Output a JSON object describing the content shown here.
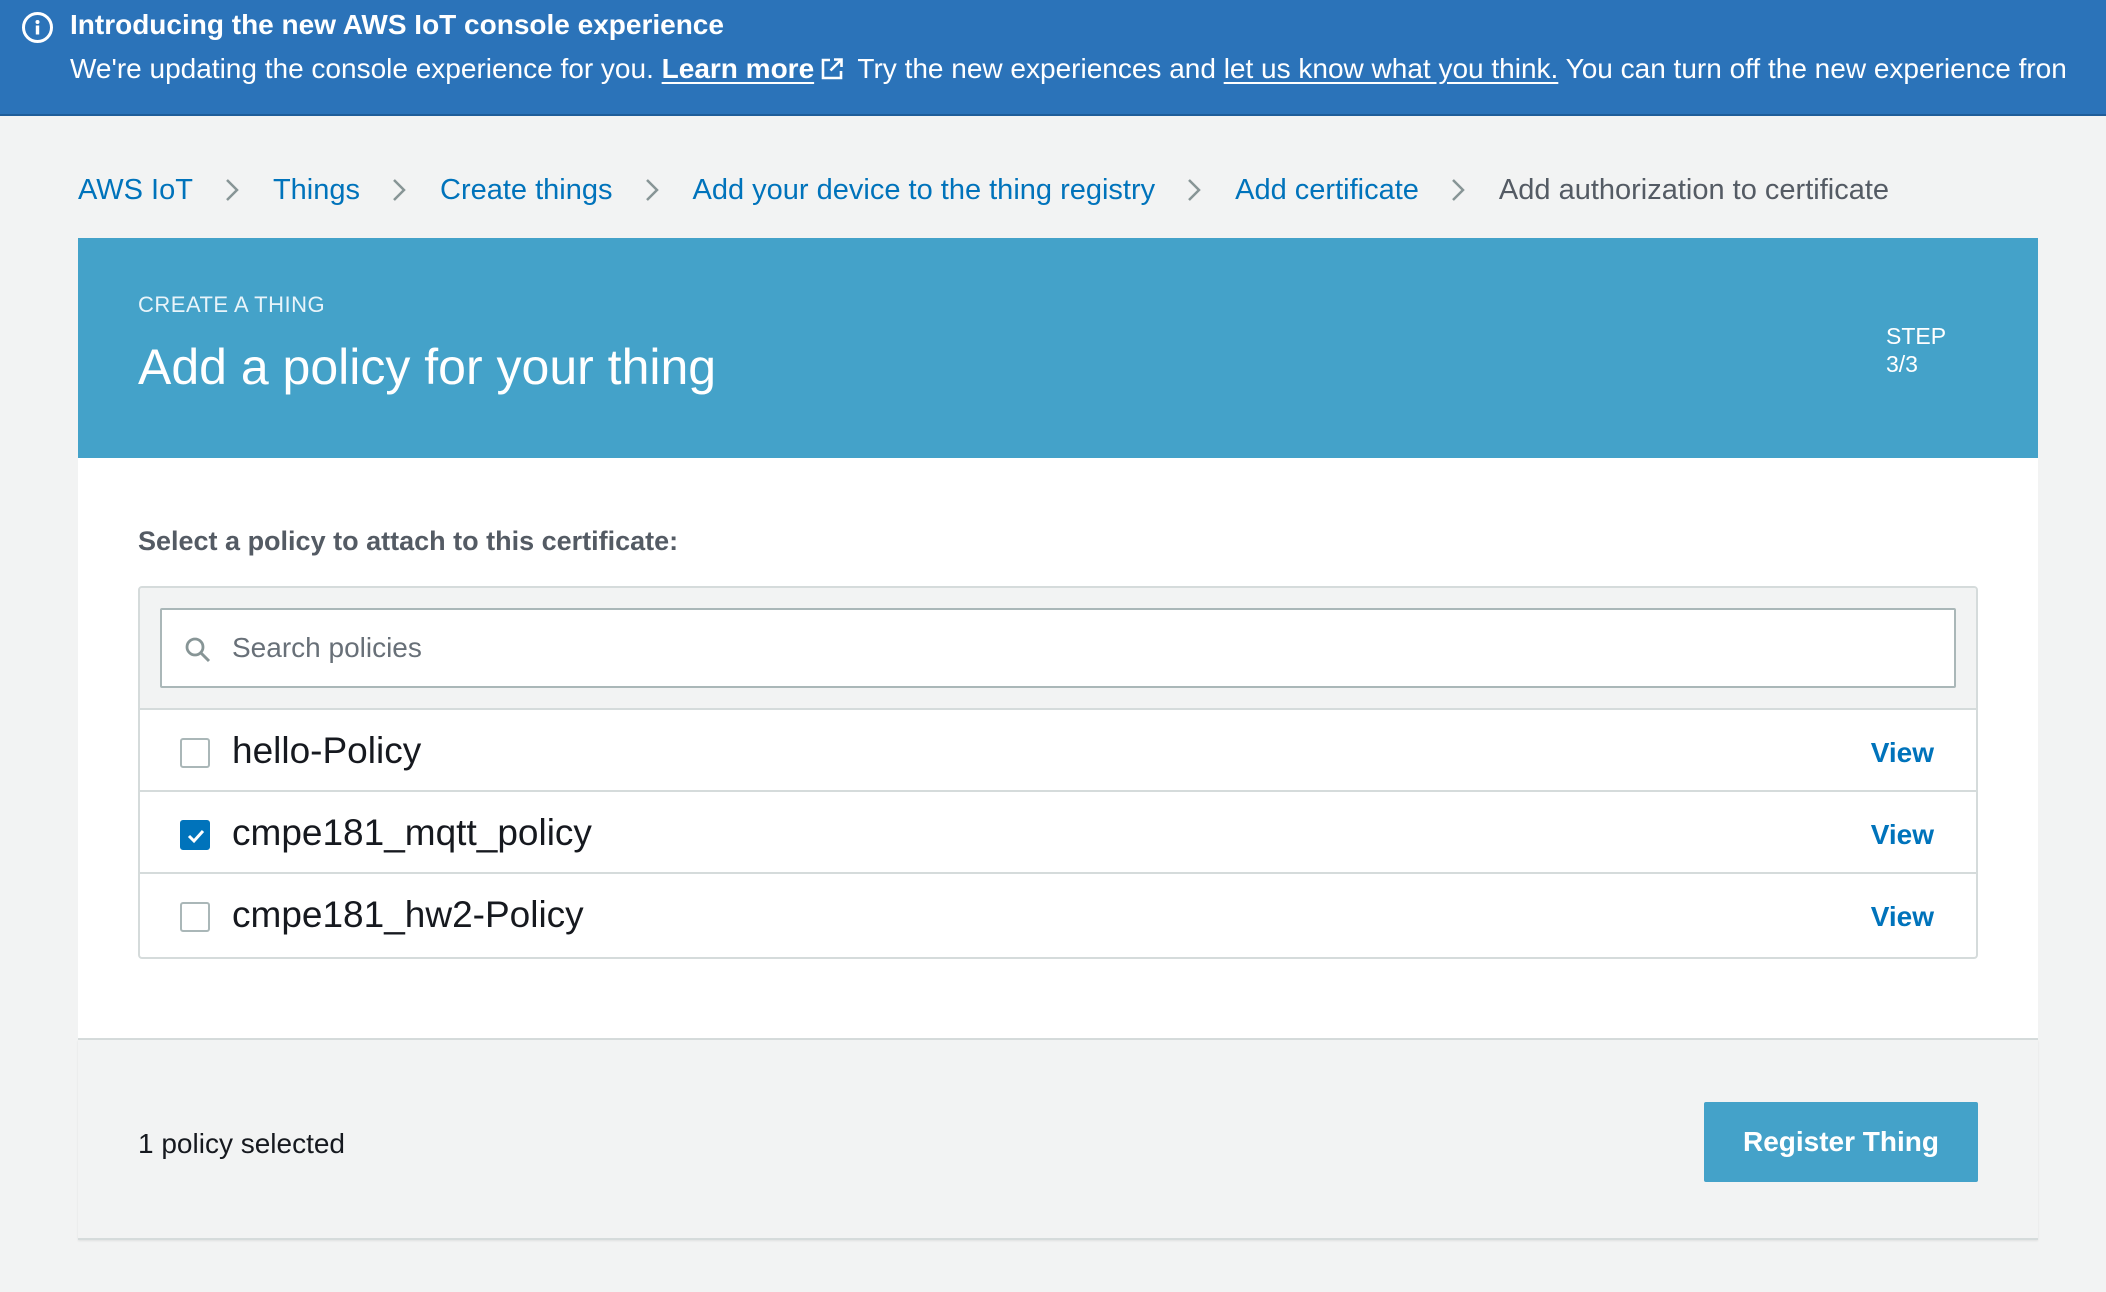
{
  "banner": {
    "title": "Introducing the new AWS IoT console experience",
    "text_before": "We're updating the console experience for you. ",
    "learn_more": "Learn more",
    "text_middle": " Try the new experiences and ",
    "feedback_link": "let us know what you think.",
    "text_after": " You can turn off the new experience fron"
  },
  "breadcrumb": {
    "items": [
      "AWS IoT",
      "Things",
      "Create things",
      "Add your device to the thing registry",
      "Add certificate",
      "Add authorization to certificate"
    ]
  },
  "header": {
    "kicker": "CREATE A THING",
    "title": "Add a policy for your thing",
    "step_label": "STEP",
    "step_value": "3/3"
  },
  "content": {
    "section_label": "Select a policy to attach to this certificate:",
    "search_placeholder": "Search policies",
    "search_value": "",
    "policies": [
      {
        "name": "hello-Policy",
        "checked": false,
        "action": "View"
      },
      {
        "name": "cmpe181_mqtt_policy",
        "checked": true,
        "action": "View"
      },
      {
        "name": "cmpe181_hw2-Policy",
        "checked": false,
        "action": "View"
      }
    ]
  },
  "footer": {
    "selected_count": "1 policy selected",
    "register_label": "Register Thing"
  },
  "icons": {
    "banner": "info-circle-icon",
    "external": "external-link-icon",
    "separator": "chevron-right-icon",
    "search": "search-icon",
    "check": "checkmark-icon"
  },
  "colors": {
    "banner_bg": "#2b73b9",
    "header_bg": "#44a2c9",
    "link": "#0073bb",
    "button_bg": "#44a2c9"
  }
}
